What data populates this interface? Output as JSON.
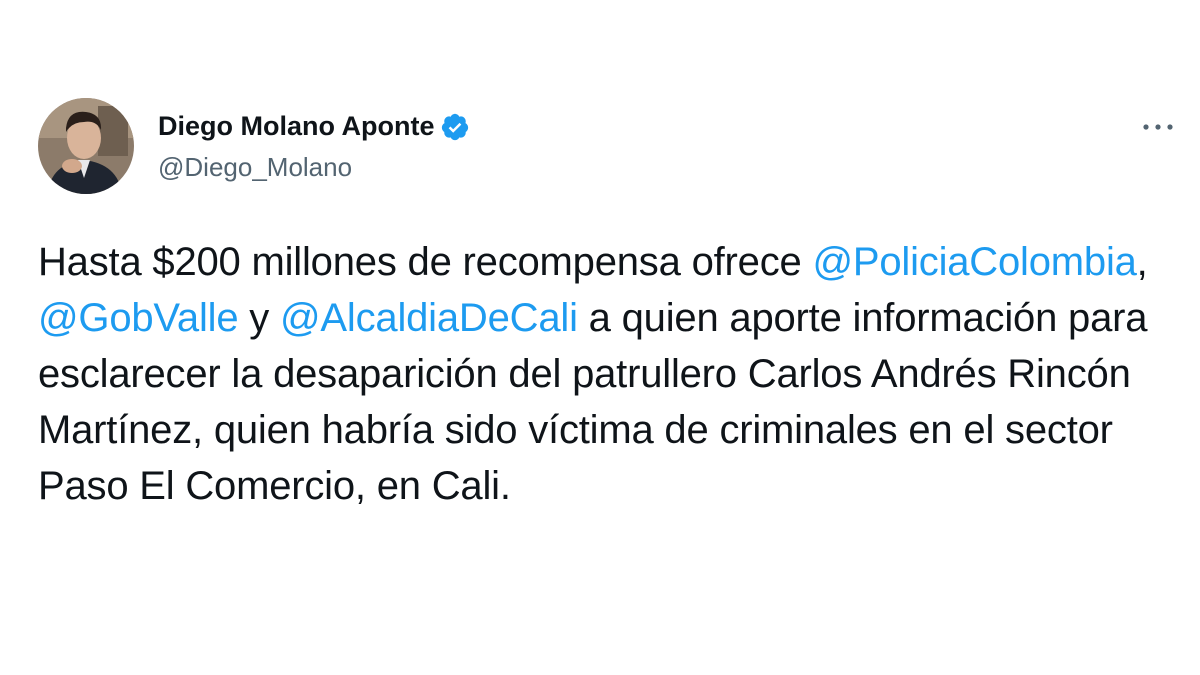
{
  "author": {
    "name": "Diego Molano Aponte",
    "handle": "@Diego_Molano",
    "verified": true
  },
  "icons": {
    "verified": "verified-badge-icon",
    "more": "more-options-icon"
  },
  "colors": {
    "mention": "#1d9bf0",
    "text": "#0f1419",
    "secondary_text": "#536471",
    "verified_badge": "#1d9bf0"
  },
  "tweet": {
    "text_1": "Hasta $200 millones de recompensa ofrece ",
    "mention_1": "@PoliciaColombia",
    "text_2": ", ",
    "mention_2": "@GobValle",
    "text_3": " y ",
    "mention_3": "@AlcaldiaDeCali",
    "text_4": " a quien aporte información para esclarecer la desaparición del patrullero Carlos Andrés Rincón Martínez, quien habría sido víctima de criminales en el sector Paso El Comercio, en Cali."
  }
}
